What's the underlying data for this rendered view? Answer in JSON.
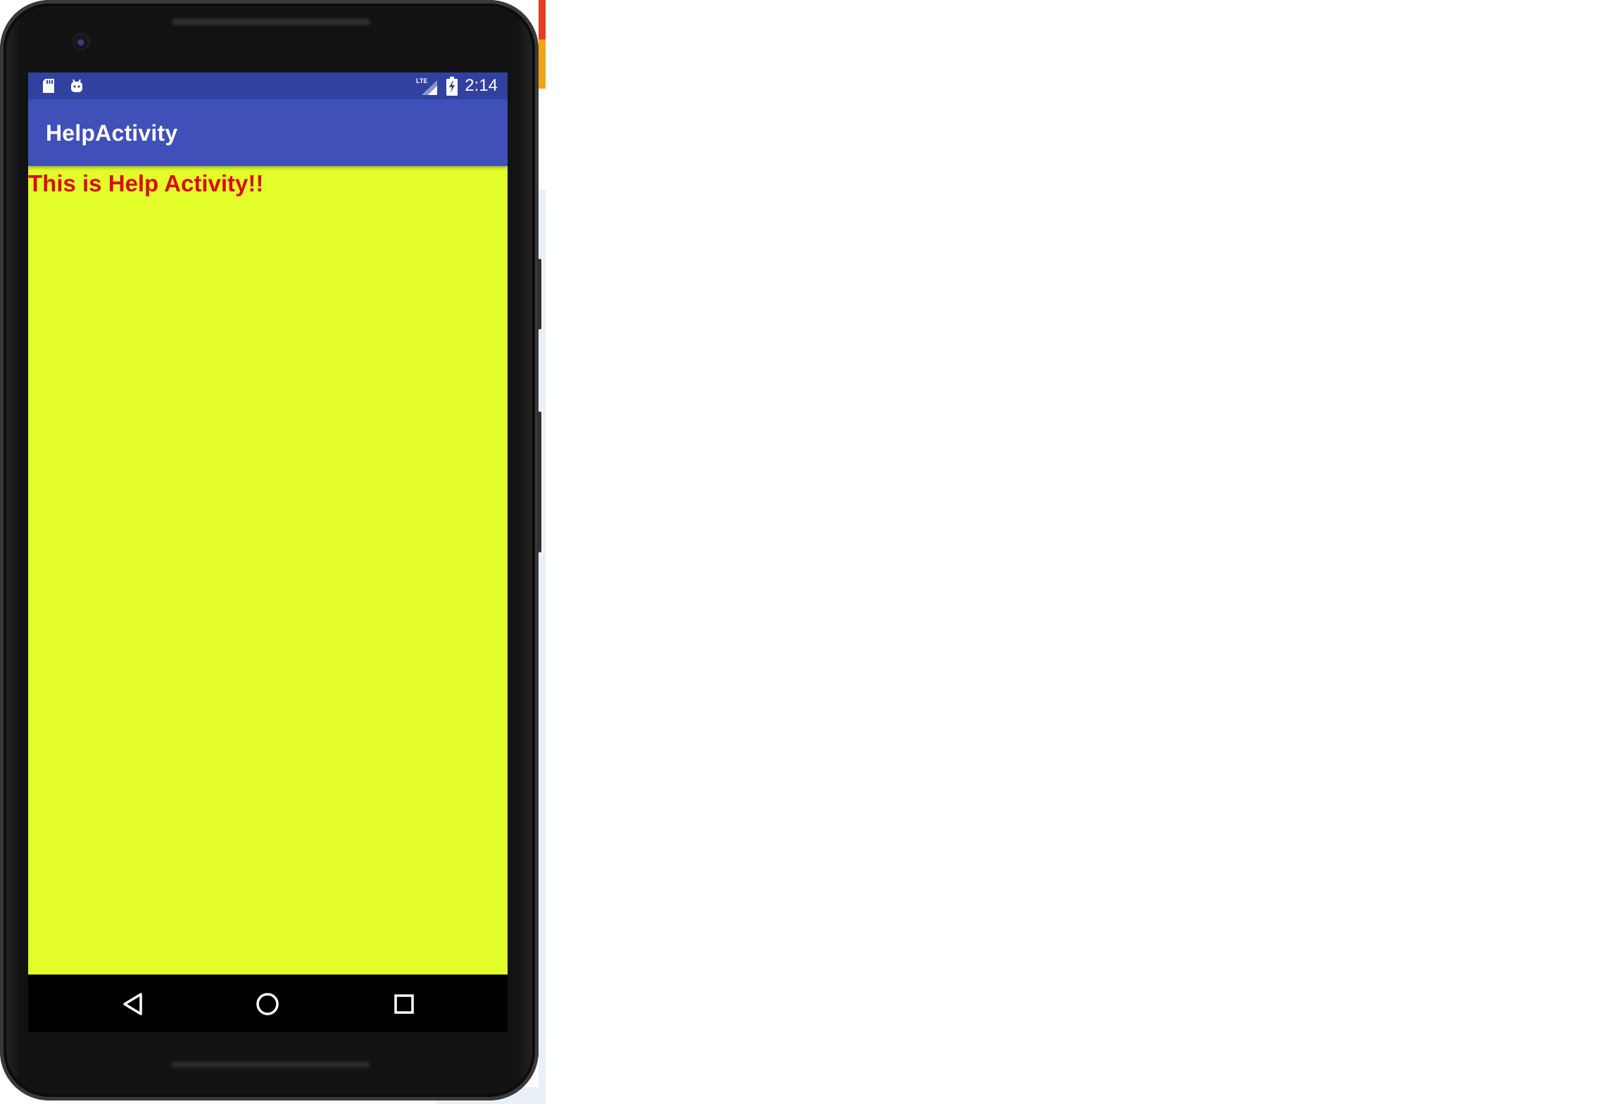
{
  "status_bar": {
    "time": "2:14",
    "network_label": "LTE",
    "left_icons": [
      "sd-card-icon",
      "android-icon"
    ],
    "right_icons": [
      "signal-icon",
      "battery-charging-icon"
    ]
  },
  "app_bar": {
    "title": "HelpActivity"
  },
  "content": {
    "message": "This is Help Activity!!"
  },
  "nav_bar": {
    "buttons": [
      "back-icon",
      "home-icon",
      "recents-icon"
    ]
  },
  "colors": {
    "status_bar": "#3041a0",
    "app_bar": "#4050b8",
    "content_background": "#e3fd2b",
    "message_text": "#d50f0f"
  }
}
